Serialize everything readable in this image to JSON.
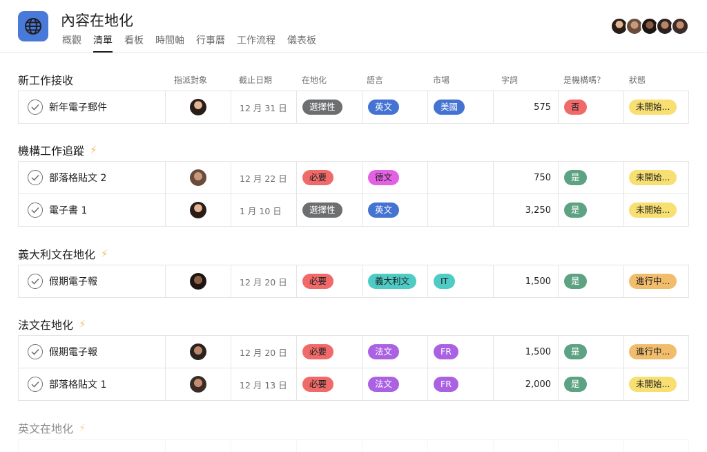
{
  "header": {
    "title": "內容在地化",
    "tabs": [
      {
        "label": "概觀",
        "active": false
      },
      {
        "label": "清單",
        "active": true
      },
      {
        "label": "看板",
        "active": false
      },
      {
        "label": "時間軸",
        "active": false
      },
      {
        "label": "行事曆",
        "active": false
      },
      {
        "label": "工作流程",
        "active": false
      },
      {
        "label": "儀表板",
        "active": false
      }
    ]
  },
  "columns": {
    "assignee": "指派對象",
    "due": "截止日期",
    "localization": "在地化",
    "language": "語言",
    "market": "市場",
    "words": "字詞",
    "org": "是機構嗎？",
    "status": "狀態"
  },
  "sections": [
    {
      "title": "新工作接收",
      "bolt": false,
      "tasks": [
        {
          "name": "新年電子郵件",
          "due": "12 月 31 日",
          "loc": "選擇性",
          "lang": "英文",
          "market": "美國",
          "words": "575",
          "org": "否",
          "status": "未開始..."
        }
      ]
    },
    {
      "title": "機構工作追蹤",
      "bolt": true,
      "tasks": [
        {
          "name": "部落格貼文 2",
          "due": "12 月 22 日",
          "loc": "必要",
          "lang": "德文",
          "market": "",
          "words": "750",
          "org": "是",
          "status": "未開始..."
        },
        {
          "name": "電子書 1",
          "due": "1 月 10 日",
          "loc": "選擇性",
          "lang": "英文",
          "market": "",
          "words": "3,250",
          "org": "是",
          "status": "未開始..."
        }
      ]
    },
    {
      "title": "義大利文在地化",
      "bolt": true,
      "tasks": [
        {
          "name": "假期電子報",
          "due": "12 月 20 日",
          "loc": "必要",
          "lang": "義大利文",
          "market": "IT",
          "words": "1,500",
          "org": "是",
          "status": "進行中..."
        }
      ]
    },
    {
      "title": "法文在地化",
      "bolt": true,
      "tasks": [
        {
          "name": "假期電子報",
          "due": "12 月 20 日",
          "loc": "必要",
          "lang": "法文",
          "market": "FR",
          "words": "1,500",
          "org": "是",
          "status": "進行中..."
        },
        {
          "name": "部落格貼文 1",
          "due": "12 月 13 日",
          "loc": "必要",
          "lang": "法文",
          "market": "FR",
          "words": "2,000",
          "org": "是",
          "status": "未開始..."
        }
      ]
    },
    {
      "title": "英文在地化",
      "bolt": true,
      "tasks": []
    }
  ],
  "colors": {
    "accent_blue": "#4573d2",
    "app_icon": "#4a7ad9",
    "required_red": "#f06a6a",
    "optional_gray": "#6d6e6f",
    "yes_green": "#5da283",
    "not_started_yellow": "#f8df72",
    "in_progress_orange": "#f1bd6c"
  },
  "icons": {
    "app": "globe-icon",
    "task_complete": "check-circle-icon",
    "section_rule": "lightning-bolt-icon"
  }
}
